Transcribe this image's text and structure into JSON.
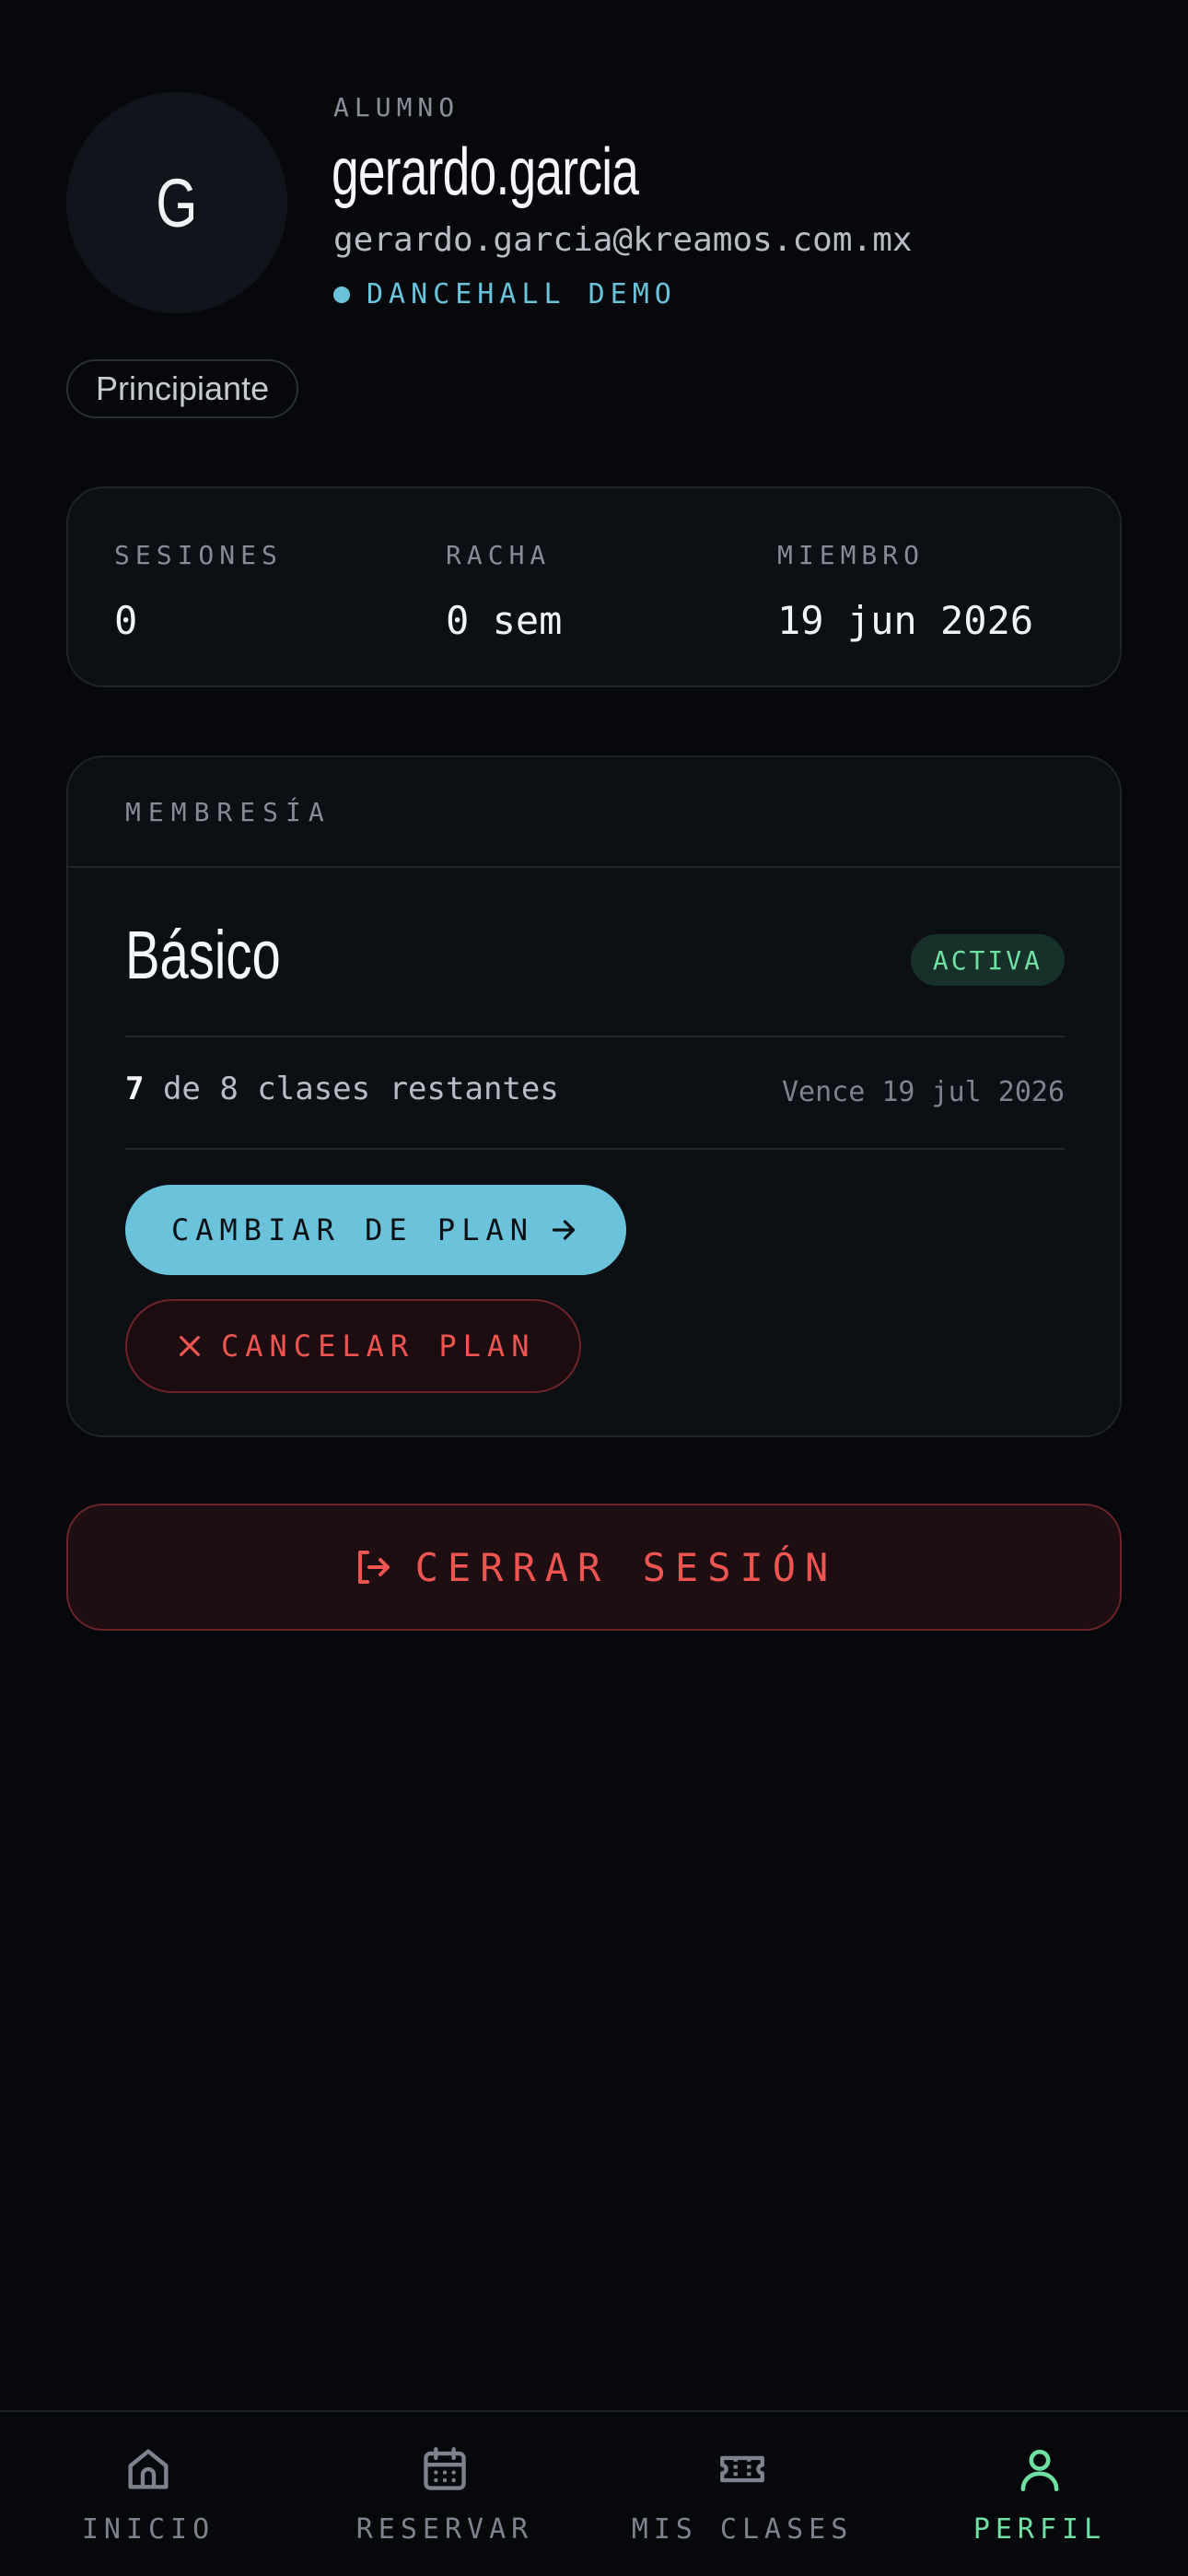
{
  "profile": {
    "avatar_letter": "G",
    "role": "ALUMNO",
    "username": "gerardo.garcia",
    "email": "gerardo.garcia@kreamos.com.mx",
    "studio": "DANCEHALL DEMO",
    "level": "Principiante"
  },
  "stats": [
    {
      "label": "SESIONES",
      "value": "0"
    },
    {
      "label": "RACHA",
      "value": "0 sem"
    },
    {
      "label": "MIEMBRO",
      "value": "19 jun 2026"
    }
  ],
  "membership": {
    "section_label": "MEMBRESÍA",
    "plan_name": "Básico",
    "status": "ACTIVA",
    "remaining_count": "7",
    "remaining_text": " de 8 clases restantes",
    "expires": "Vence 19 jul 2026",
    "change_label": "CAMBIAR DE PLAN",
    "cancel_label": "CANCELAR PLAN"
  },
  "logout_label": "CERRAR SESIÓN",
  "nav": [
    {
      "label": "INICIO",
      "icon": "home-icon",
      "active": false
    },
    {
      "label": "RESERVAR",
      "icon": "calendar-icon",
      "active": false
    },
    {
      "label": "MIS CLASES",
      "icon": "ticket-icon",
      "active": false
    },
    {
      "label": "PERFIL",
      "icon": "user-icon",
      "active": true
    }
  ],
  "colors": {
    "accent": "#6ac3db",
    "success": "#6ee0a1",
    "danger": "#ee5550",
    "background": "#07080c"
  }
}
